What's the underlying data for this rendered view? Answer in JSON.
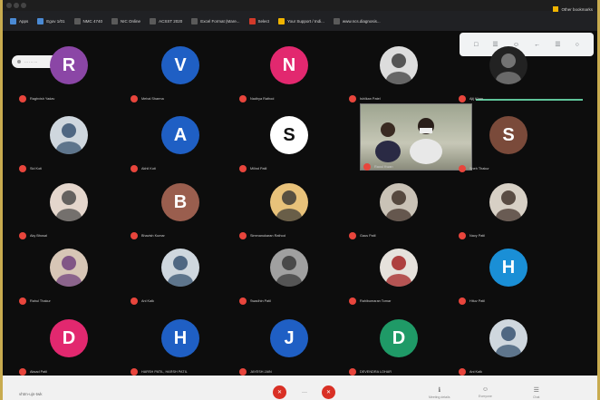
{
  "bookmarks": [
    {
      "label": "Apps",
      "color": "#4a8ad4"
    },
    {
      "label": "Egov 1/01",
      "color": "#4a8ad4"
    },
    {
      "label": "NMC 4740",
      "color": "#5a5a5a"
    },
    {
      "label": "NIC Online",
      "color": "#5a5a5a"
    },
    {
      "label": "ACSST 2020",
      "color": "#5a5a5a"
    },
    {
      "label": "Excel Format (Mare...",
      "color": "#5a5a5a"
    },
    {
      "label": "Select",
      "color": "#d23a2a"
    },
    {
      "label": "Your Support / Indi...",
      "color": "#f0b400"
    },
    {
      "label": "www.ncs.diagnosis...",
      "color": "#5a5a5a"
    }
  ],
  "other_bookmarks": "Other bookmarks",
  "meeting_pill": "··· ··· ···",
  "top_panel_icons": [
    "□",
    "☰",
    "☺",
    "←",
    "☰",
    "○"
  ],
  "participants": [
    {
      "type": "letter",
      "letter": "R",
      "color": "#8b46a6",
      "name": "Raghvish Yadav"
    },
    {
      "type": "letter",
      "letter": "V",
      "color": "#1f5fc4",
      "name": "Mehal Sharma"
    },
    {
      "type": "letter",
      "letter": "N",
      "color": "#e2286f",
      "name": "Nadhya Rathod"
    },
    {
      "type": "photo",
      "name": "Ishilkan Patel",
      "bg": "#ddd",
      "fg": "#333"
    },
    {
      "type": "photo",
      "name": "Ajij Khan",
      "bg": "#222",
      "fg": "#888"
    },
    {
      "type": "photo",
      "name": "Sid Koti",
      "bg": "#cfd7de",
      "fg": "#2e4b6a"
    },
    {
      "type": "letter",
      "letter": "A",
      "color": "#1f5fc4",
      "name": "Akhil Koti"
    },
    {
      "type": "letter",
      "letter": "S",
      "color": "#ffffff",
      "textColor": "#111",
      "name": "Milind Patil"
    },
    {
      "type": "video",
      "name": "Raoul Kwan"
    },
    {
      "type": "letter",
      "letter": "S",
      "color": "#7a4a3a",
      "name": "Sneh Thakur"
    },
    {
      "type": "photo",
      "name": "Aky Bhosal",
      "bg": "#e4d6cc",
      "fg": "#444"
    },
    {
      "type": "letter",
      "letter": "B",
      "color": "#9a5e4e",
      "name": "Bhavish Kumar"
    },
    {
      "type": "photo",
      "name": "Simmanukaran Rathod",
      "bg": "#e8c27a",
      "fg": "#333"
    },
    {
      "type": "photo",
      "name": "Gaus Patil",
      "bg": "#c9c2b6",
      "fg": "#3a2a22"
    },
    {
      "type": "photo",
      "name": "Navy Patil",
      "bg": "#d7d0c5",
      "fg": "#3a2a22"
    },
    {
      "type": "photo",
      "name": "Rahul Thakur",
      "bg": "#d7c6b6",
      "fg": "#6b3a7a"
    },
    {
      "type": "photo",
      "name": "Ani Kalk",
      "bg": "#cfd7de",
      "fg": "#2e4b6a"
    },
    {
      "type": "photo",
      "name": "Swadhin Patil",
      "bg": "#a0a0a0",
      "fg": "#333"
    },
    {
      "type": "photo",
      "name": "Rahibumaran Tomar",
      "bg": "#e6e2dc",
      "fg": "#a01818"
    },
    {
      "type": "letter",
      "letter": "H",
      "color": "#1a8fd6",
      "name": "Hituv Patil"
    },
    {
      "type": "letter",
      "letter": "D",
      "color": "#e2286f",
      "name": "Aksad Patil"
    },
    {
      "type": "letter",
      "letter": "H",
      "color": "#1f5fc4",
      "name": "HARSH PATIL, HARSH PATIL"
    },
    {
      "type": "letter",
      "letter": "J",
      "color": "#1f5fc4",
      "name": "JAYESH JAIN"
    },
    {
      "type": "letter",
      "letter": "D",
      "color": "#1f9a67",
      "name": "DEVENDRA LOHAR"
    },
    {
      "type": "photo",
      "name": "Ani Kalk",
      "bg": "#cfd7de",
      "fg": "#2e4b6a"
    }
  ],
  "bottom": {
    "meeting_code": "vhtm-ujn-twk",
    "end_label": "✕",
    "more": "···",
    "right_items": [
      {
        "icon": "ℹ",
        "label": "Meeting details"
      },
      {
        "icon": "☺",
        "label": "Everyone"
      },
      {
        "icon": "☰",
        "label": "Chat"
      }
    ]
  }
}
